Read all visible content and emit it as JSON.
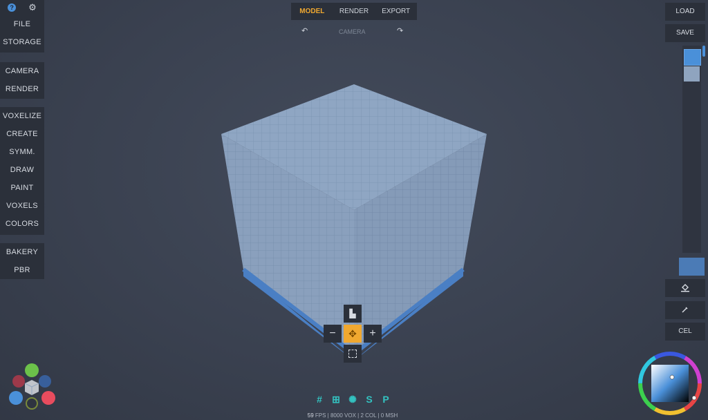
{
  "left_panel": {
    "help_icon": "?",
    "group1": [
      "FILE",
      "STORAGE"
    ],
    "group2": [
      "CAMERA",
      "RENDER"
    ],
    "group3": [
      "VOXELIZE",
      "CREATE",
      "SYMM.",
      "DRAW",
      "PAINT",
      "VOXELS",
      "COLORS"
    ],
    "group4": [
      "BAKERY",
      "PBR"
    ]
  },
  "top_tabs": [
    "MODEL",
    "RENDER",
    "EXPORT"
  ],
  "camera_label": "CAMERA",
  "right_panel": {
    "load": "LOAD",
    "save": "SAVE",
    "cel": "CEL"
  },
  "palette_colors": [
    "#4a90d9",
    "#8fa4bf"
  ],
  "current_color": "#4b7bb6",
  "bottom_icons": [
    "grid-icon",
    "grid-square-icon",
    "light-icon",
    "S",
    "P"
  ],
  "stats": {
    "fps": "59",
    "fps_label": "FPS",
    "vox": "8000 VOX",
    "col": "2 COL",
    "msh": "0 MSH"
  }
}
